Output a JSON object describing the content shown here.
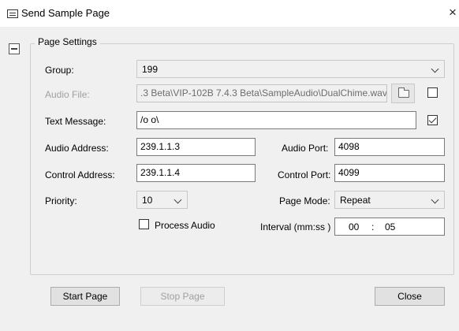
{
  "window": {
    "title": "Send Sample Page",
    "close_glyph": "×"
  },
  "page_settings": {
    "legend": "Page Settings",
    "group": {
      "label": "Group:",
      "value": "199"
    },
    "audio_file": {
      "label": "Audio File:",
      "value": ".3 Beta\\VIP-102B 7.4.3 Beta\\SampleAudio\\DualChime.wav",
      "checked": false
    },
    "text_message": {
      "label": "Text Message:",
      "value": "/o o\\",
      "checked": true
    },
    "audio_address": {
      "label": "Audio Address:",
      "value": "239.1.1.3"
    },
    "audio_port": {
      "label": "Audio Port:",
      "value": "4098"
    },
    "control_address": {
      "label": "Control Address:",
      "value": "239.1.1.4"
    },
    "control_port": {
      "label": "Control Port:",
      "value": "4099"
    },
    "priority": {
      "label": "Priority:",
      "value": "10"
    },
    "page_mode": {
      "label": "Page Mode:",
      "value": "Repeat"
    },
    "process_audio": {
      "label": "Process Audio",
      "checked": false
    },
    "interval": {
      "label": "Interval (mm:ss )",
      "minutes": "00",
      "separator": ":",
      "seconds": "05"
    }
  },
  "buttons": {
    "start": "Start Page",
    "stop": "Stop Page",
    "close": "Close"
  }
}
